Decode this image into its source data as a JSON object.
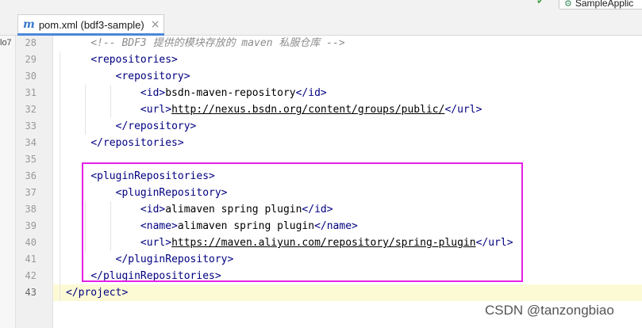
{
  "tab": {
    "icon": "m",
    "label": "pom.xml (bdf3-sample)",
    "close": "×"
  },
  "toolbar": {
    "run_config_label": "SampleApplic",
    "hammer_icon": "hammer-icon",
    "run_icon": "spring-boot-icon"
  },
  "project_panel": {
    "fragment": "lo7"
  },
  "lines": [
    {
      "num": "28",
      "parts": [
        {
          "t": "    <!-- BDF3 提供的模块存放的 maven 私服仓库 -->",
          "s": "c"
        }
      ]
    },
    {
      "num": "29",
      "parts": [
        {
          "t": "    "
        },
        {
          "t": "<repositories>",
          "s": "t"
        }
      ]
    },
    {
      "num": "30",
      "parts": [
        {
          "t": "        "
        },
        {
          "t": "<repository>",
          "s": "t"
        }
      ]
    },
    {
      "num": "31",
      "parts": [
        {
          "t": "            "
        },
        {
          "t": "<id>",
          "s": "t"
        },
        {
          "t": "bsdn-maven-repository"
        },
        {
          "t": "</id>",
          "s": "t"
        }
      ]
    },
    {
      "num": "32",
      "parts": [
        {
          "t": "            "
        },
        {
          "t": "<url>",
          "s": "t"
        },
        {
          "t": "http://nexus.bsdn.org/content/groups/public/",
          "s": "u"
        },
        {
          "t": "</url>",
          "s": "t"
        }
      ]
    },
    {
      "num": "33",
      "parts": [
        {
          "t": "        "
        },
        {
          "t": "</repository>",
          "s": "t"
        }
      ]
    },
    {
      "num": "34",
      "parts": [
        {
          "t": "    "
        },
        {
          "t": "</repositories>",
          "s": "t"
        }
      ]
    },
    {
      "num": "35",
      "parts": []
    },
    {
      "num": "36",
      "parts": [
        {
          "t": "    "
        },
        {
          "t": "<pluginRepositories>",
          "s": "t"
        }
      ]
    },
    {
      "num": "37",
      "parts": [
        {
          "t": "        "
        },
        {
          "t": "<pluginRepository>",
          "s": "t"
        }
      ]
    },
    {
      "num": "38",
      "parts": [
        {
          "t": "            "
        },
        {
          "t": "<id>",
          "s": "t"
        },
        {
          "t": "alimaven spring plugin"
        },
        {
          "t": "</id>",
          "s": "t"
        }
      ]
    },
    {
      "num": "39",
      "parts": [
        {
          "t": "            "
        },
        {
          "t": "<name>",
          "s": "t"
        },
        {
          "t": "alimaven spring plugin"
        },
        {
          "t": "</name>",
          "s": "t"
        }
      ]
    },
    {
      "num": "40",
      "parts": [
        {
          "t": "            "
        },
        {
          "t": "<url>",
          "s": "t"
        },
        {
          "t": "https://maven.aliyun.com/repository/spring-plugin",
          "s": "u"
        },
        {
          "t": "</url>",
          "s": "t"
        }
      ]
    },
    {
      "num": "41",
      "parts": [
        {
          "t": "        "
        },
        {
          "t": "</pluginRepository>",
          "s": "t"
        }
      ]
    },
    {
      "num": "42",
      "parts": [
        {
          "t": "    "
        },
        {
          "t": "</pluginRepositories>",
          "s": "t"
        }
      ]
    },
    {
      "num": "43",
      "parts": [
        {
          "t": "</project>",
          "s": "t"
        }
      ],
      "current": true
    }
  ],
  "watermark": "CSDN @tanzongbiao",
  "colors": {
    "highlight_box": "#e620e6",
    "tag": "#000080",
    "comment": "#8c8c8c",
    "current_line": "#fcfad5"
  }
}
